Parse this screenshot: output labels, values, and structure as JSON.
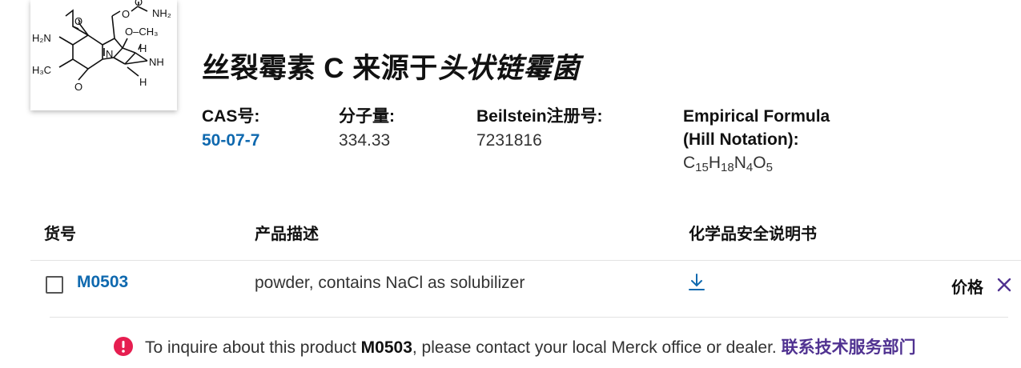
{
  "structure": {
    "labels": {
      "nh2_top": "NH₂",
      "h2n": "H₂N",
      "o1": "O",
      "o2": "O",
      "o3": "O",
      "o4": "O",
      "och3": "O–CH₃",
      "h3c": "H₃C",
      "n": "N",
      "nh": "NH",
      "h1": "H",
      "h2": "H"
    }
  },
  "product": {
    "title_normal": "丝裂霉素 C 来源于",
    "title_italic": "头状链霉菌",
    "properties": [
      {
        "label": "CAS号:",
        "value": "50-07-7"
      },
      {
        "label": "分子量:",
        "value": "334.33"
      },
      {
        "label": "Beilstein注册号:",
        "value": "7231816"
      },
      {
        "label_line1": "Empirical Formula",
        "label_line2": "(Hill Notation):",
        "formula": {
          "C": "C",
          "c_n": "15",
          "H": "H",
          "h_n": "18",
          "N": "N",
          "n_n": "4",
          "O": "O",
          "o_n": "5"
        }
      }
    ]
  },
  "table": {
    "headers": {
      "sku": "货号",
      "description": "产品描述",
      "sds": "化学品安全说明书"
    },
    "row": {
      "sku": "M0503",
      "description": "powder, contains NaCl as solubilizer",
      "sds_icon": "download-icon",
      "price_label": "价格",
      "close_icon": "close-icon"
    }
  },
  "notice": {
    "icon": "error-icon",
    "text_before": "To inquire about this product ",
    "product": "M0503",
    "text_after": ", please contact your local Merck office or dealer. ",
    "link": "联系技术服务部门"
  },
  "colors": {
    "link_blue": "#0f69af",
    "contact_purple": "#503291",
    "error_red": "#e61e50"
  }
}
